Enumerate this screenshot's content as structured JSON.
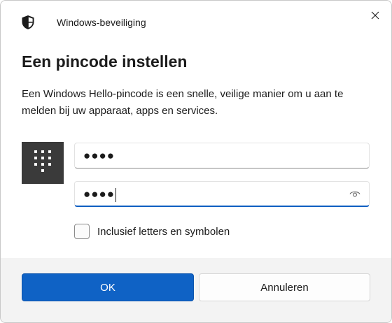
{
  "window": {
    "app_title": "Windows-beveiliging",
    "close_label": "Sluiten"
  },
  "dialog": {
    "heading": "Een pincode instellen",
    "description": "Een Windows Hello-pincode is een snelle, veilige manier om u aan te melden bij uw apparaat, apps en services."
  },
  "fields": {
    "pin": {
      "value": "●●●●",
      "masked": true
    },
    "confirm_pin": {
      "value": "●●●●",
      "masked": true,
      "focused": true
    }
  },
  "options": {
    "include_letters_label": "Inclusief letters en symbolen",
    "include_letters_checked": false
  },
  "buttons": {
    "ok_label": "OK",
    "cancel_label": "Annuleren"
  },
  "icons": {
    "app": "shield-icon",
    "close": "close-icon",
    "pin_tile": "keypad-icon",
    "reveal": "eye-icon"
  },
  "colors": {
    "accent": "#0f62c5",
    "pin_tile_bg": "#3a3a3a",
    "footer_bg": "#f3f3f3"
  }
}
